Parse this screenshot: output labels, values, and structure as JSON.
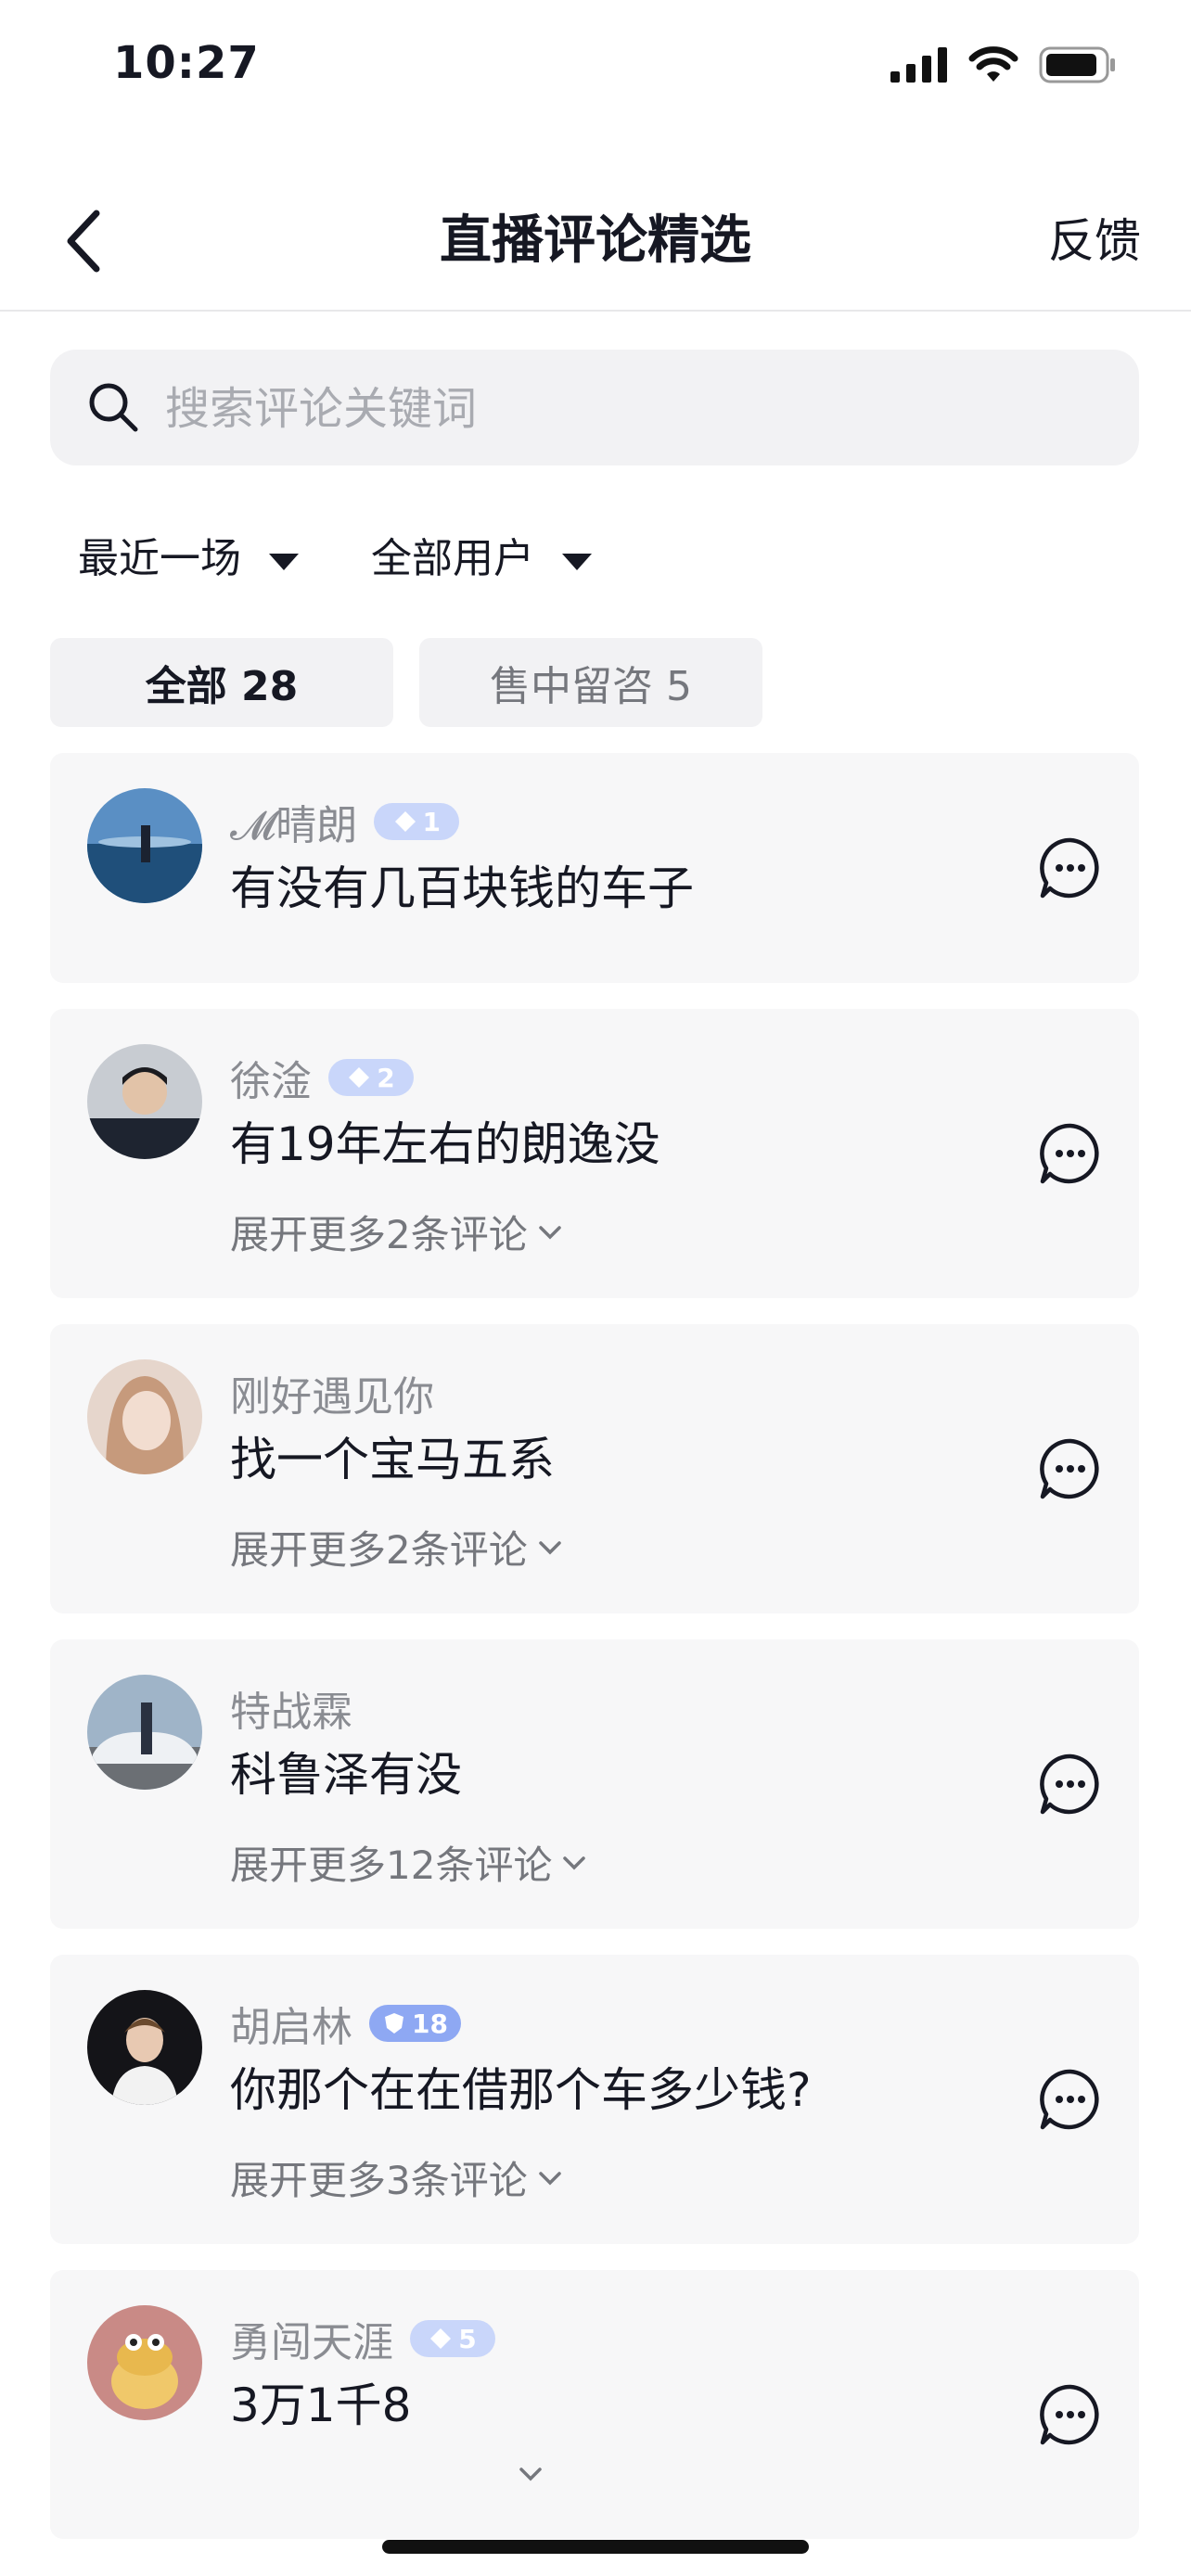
{
  "status_bar": {
    "time": "10:27"
  },
  "nav": {
    "title": "直播评论精选",
    "feedback": "反馈"
  },
  "search": {
    "placeholder": "搜索评论关键词"
  },
  "filters": [
    {
      "label": "最近一场"
    },
    {
      "label": "全部用户"
    }
  ],
  "tabs": [
    {
      "label": "全部 28",
      "active": true
    },
    {
      "label": "售中留咨 5",
      "active": false
    }
  ],
  "comments": [
    {
      "name": "𝓜晴朗",
      "badge": "1",
      "text": "有没有几百块钱的车子",
      "expand": "",
      "avatar_color": "#3f6fa3"
    },
    {
      "name": "徐淦",
      "badge": "2",
      "text": "有19年左右的朗逸没",
      "expand": "展开更多2条评论",
      "avatar_color": "#2d3440"
    },
    {
      "name": "刚好遇见你",
      "badge": "",
      "text": "找一个宝马五系",
      "expand": "展开更多2条评论",
      "avatar_color": "#d9b8a6"
    },
    {
      "name": "特战霖",
      "badge": "",
      "text": "科鲁泽有没",
      "expand": "展开更多12条评论",
      "avatar_color": "#8ca1b8"
    },
    {
      "name": "胡启林",
      "badge": "18",
      "text": "你那个在在借那个车多少钱?",
      "expand": "展开更多3条评论",
      "avatar_color": "#1b1b1f"
    },
    {
      "name": "勇闯天涯",
      "badge": "5",
      "text": "3万1千8",
      "expand": "",
      "avatar_color": "#c98a86"
    }
  ],
  "colors": {
    "accent_badge": "#c9d6fa",
    "card_bg": "#f7f7f8",
    "muted_text": "#8a8c92"
  }
}
